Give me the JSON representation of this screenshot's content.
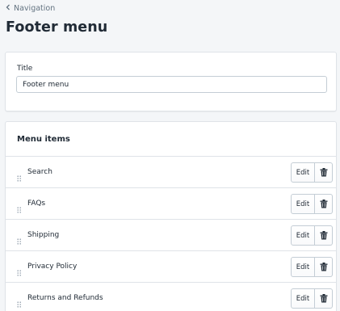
{
  "breadcrumb": {
    "label": "Navigation",
    "icon": "chevron-left-icon"
  },
  "page_title": "Footer menu",
  "title_card": {
    "label": "Title",
    "value": "Footer menu"
  },
  "menu_card": {
    "heading": "Menu items",
    "edit_label": "Edit",
    "items": [
      {
        "label": "Search"
      },
      {
        "label": "FAQs"
      },
      {
        "label": "Shipping"
      },
      {
        "label": "Privacy Policy"
      },
      {
        "label": "Returns and Refunds"
      }
    ]
  },
  "colors": {
    "background": "#f4f6f8",
    "text": "#212b36",
    "muted": "#637381",
    "border": "#dfe3e8"
  }
}
